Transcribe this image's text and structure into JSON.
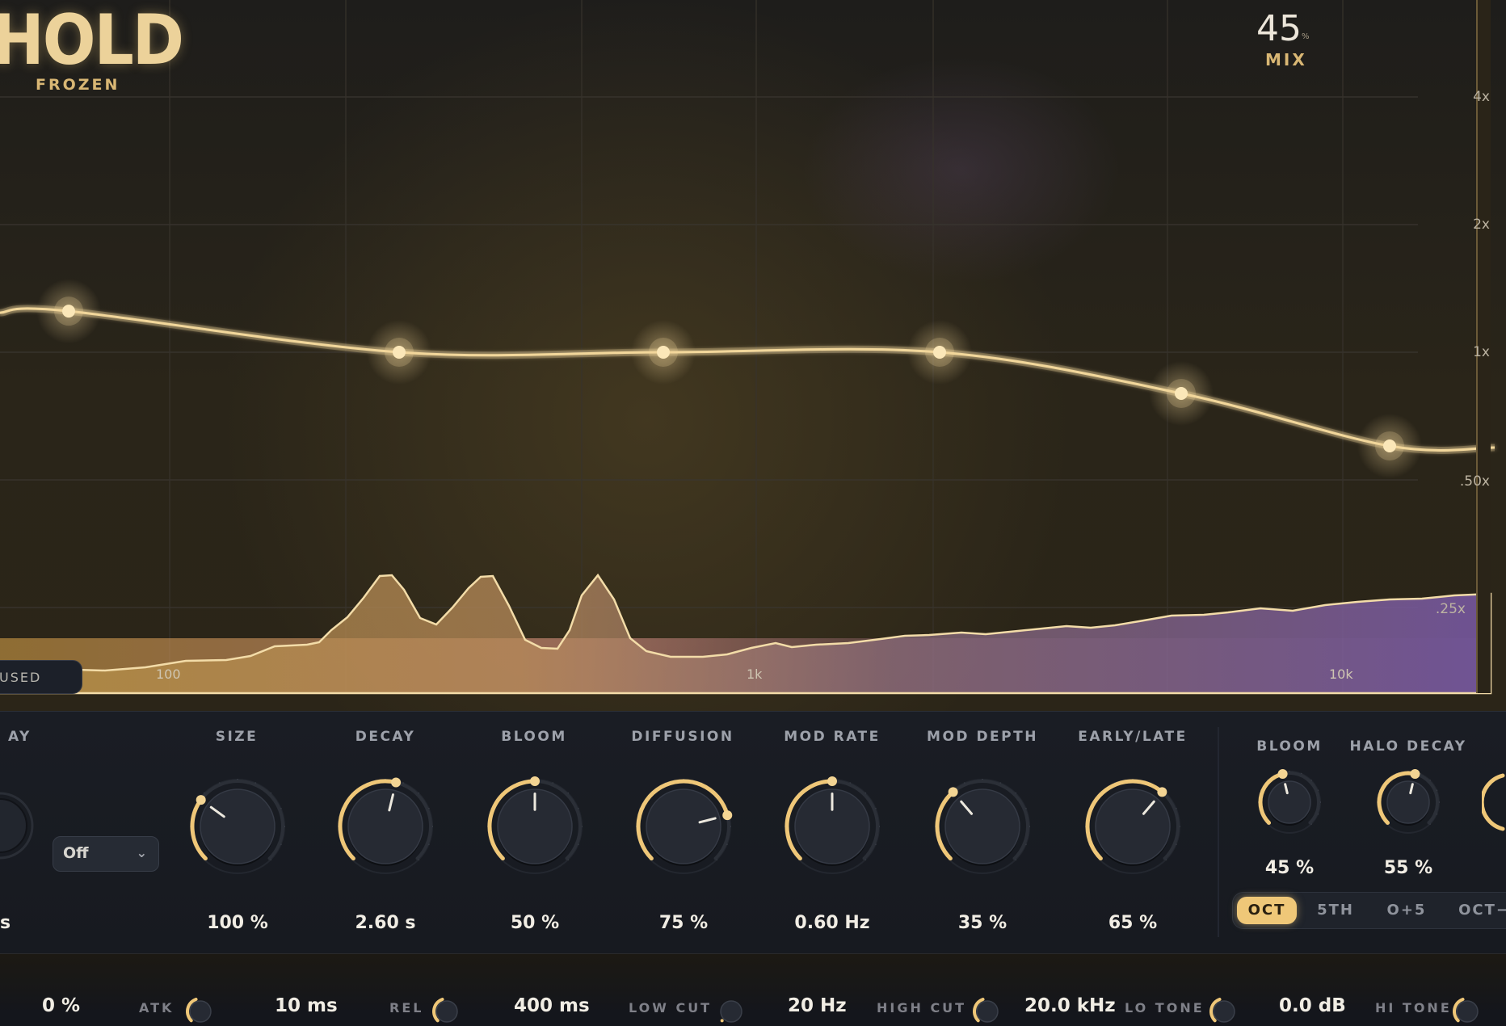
{
  "header": {
    "title": "HOLD",
    "subtitle": "FROZEN",
    "mix_value": "45",
    "mix_unit": "%",
    "mix_label": "MIX"
  },
  "graph": {
    "y_labels": [
      "4x",
      "2x",
      "1x",
      ".50x",
      ".25x"
    ],
    "x_labels": [
      "100",
      "1k",
      "10k"
    ],
    "mode_label": "USED",
    "band_points_gain": [
      1.25,
      1.0,
      1.0,
      1.0,
      0.75,
      0.5
    ],
    "colors": {
      "curve": "#f2d79b",
      "accent": "#efc778",
      "spectrum_warm": "#c8a25a",
      "spectrum_cool": "#7a5aa0"
    }
  },
  "main_knobs": {
    "partial_label": "AY",
    "partial_value": "s",
    "dropdown_value": "Off",
    "items": [
      {
        "label": "SIZE",
        "value": "100 %",
        "level": 0.3
      },
      {
        "label": "DECAY",
        "value": "2.60 s",
        "level": 0.55
      },
      {
        "label": "BLOOM",
        "value": "50 %",
        "level": 0.5
      },
      {
        "label": "DIFFUSION",
        "value": "75 %",
        "level": 0.78
      },
      {
        "label": "MOD RATE",
        "value": "0.60 Hz",
        "level": 0.5
      },
      {
        "label": "MOD DEPTH",
        "value": "35 %",
        "level": 0.35
      },
      {
        "label": "EARLY/LATE",
        "value": "65 %",
        "level": 0.65
      }
    ]
  },
  "halo": {
    "items": [
      {
        "label": "BLOOM",
        "value": "45 %",
        "level": 0.45
      },
      {
        "label": "HALO DECAY",
        "value": "55 %",
        "level": 0.55
      }
    ],
    "intervals": [
      "OCT",
      "5TH",
      "O+5",
      "OCT−"
    ],
    "active_interval": "OCT"
  },
  "bottom": {
    "values": [
      "0 %",
      "10 ms",
      "400 ms",
      "20 Hz",
      "20.0 kHz",
      "0.0 dB"
    ],
    "labels": [
      "ATK",
      "REL",
      "LOW CUT",
      "HIGH CUT",
      "LO TONE",
      "HI TONE"
    ]
  }
}
